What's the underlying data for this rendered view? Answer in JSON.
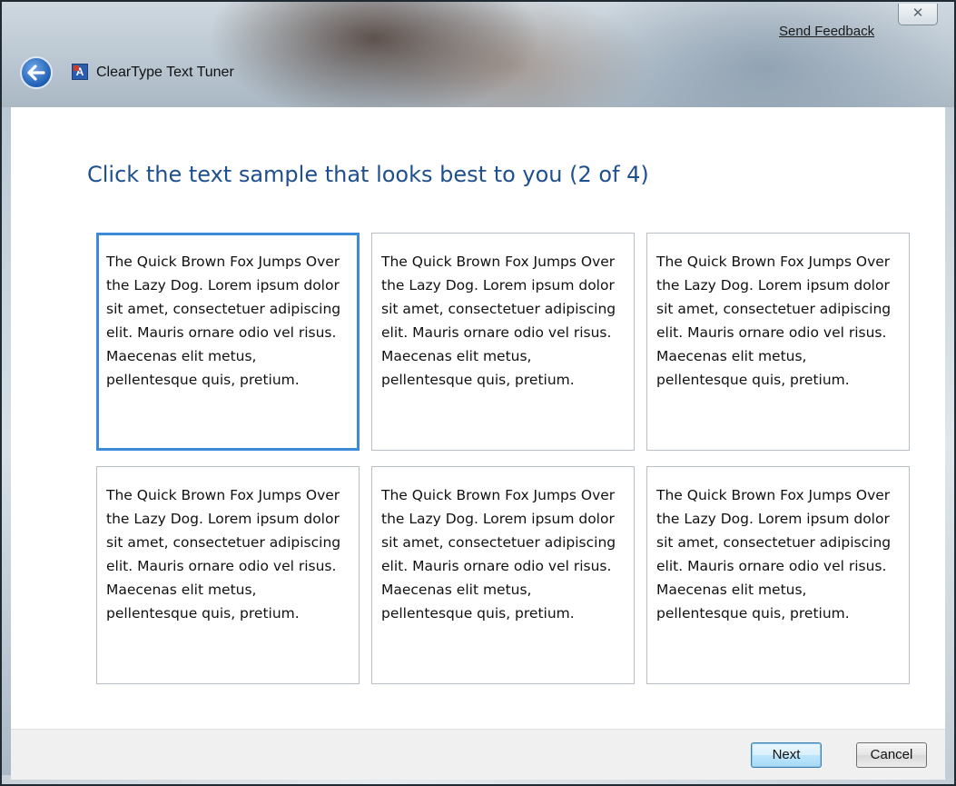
{
  "window": {
    "close_glyph": "✕",
    "send_feedback": "Send Feedback",
    "app_icon_letter": "A",
    "app_title": "ClearType Text Tuner"
  },
  "main": {
    "heading": "Click the text sample that looks best to you (2 of 4)",
    "selected_sample_index": 0,
    "samples": [
      "The Quick Brown Fox Jumps Over the Lazy Dog. Lorem ipsum dolor sit amet, consectetuer adipiscing elit. Mauris ornare odio vel risus. Maecenas elit metus, pellentesque quis, pretium.",
      "The Quick Brown Fox Jumps Over the Lazy Dog. Lorem ipsum dolor sit amet, consectetuer adipiscing elit. Mauris ornare odio vel risus. Maecenas elit metus, pellentesque quis, pretium.",
      "The Quick Brown Fox Jumps Over the Lazy Dog. Lorem ipsum dolor sit amet, consectetuer adipiscing elit. Mauris ornare odio vel risus. Maecenas elit metus, pellentesque quis, pretium.",
      "The Quick Brown Fox Jumps Over the Lazy Dog. Lorem ipsum dolor sit amet, consectetuer adipiscing elit. Mauris ornare odio vel risus. Maecenas elit metus, pellentesque quis, pretium.",
      "The Quick Brown Fox Jumps Over the Lazy Dog. Lorem ipsum dolor sit amet, consectetuer adipiscing elit. Mauris ornare odio vel risus. Maecenas elit metus, pellentesque quis, pretium.",
      "The Quick Brown Fox Jumps Over the Lazy Dog. Lorem ipsum dolor sit amet, consectetuer adipiscing elit. Mauris ornare odio vel risus. Maecenas elit metus, pellentesque quis, pretium."
    ]
  },
  "footer": {
    "next_label": "Next",
    "cancel_label": "Cancel"
  },
  "icons": {
    "back": "back-arrow-icon",
    "app": "cleartype-app-icon",
    "close": "close-icon"
  },
  "colors": {
    "heading": "#1e4f8f",
    "selection_border": "#3c8ad8",
    "footer_bg": "#f0f0f0"
  }
}
